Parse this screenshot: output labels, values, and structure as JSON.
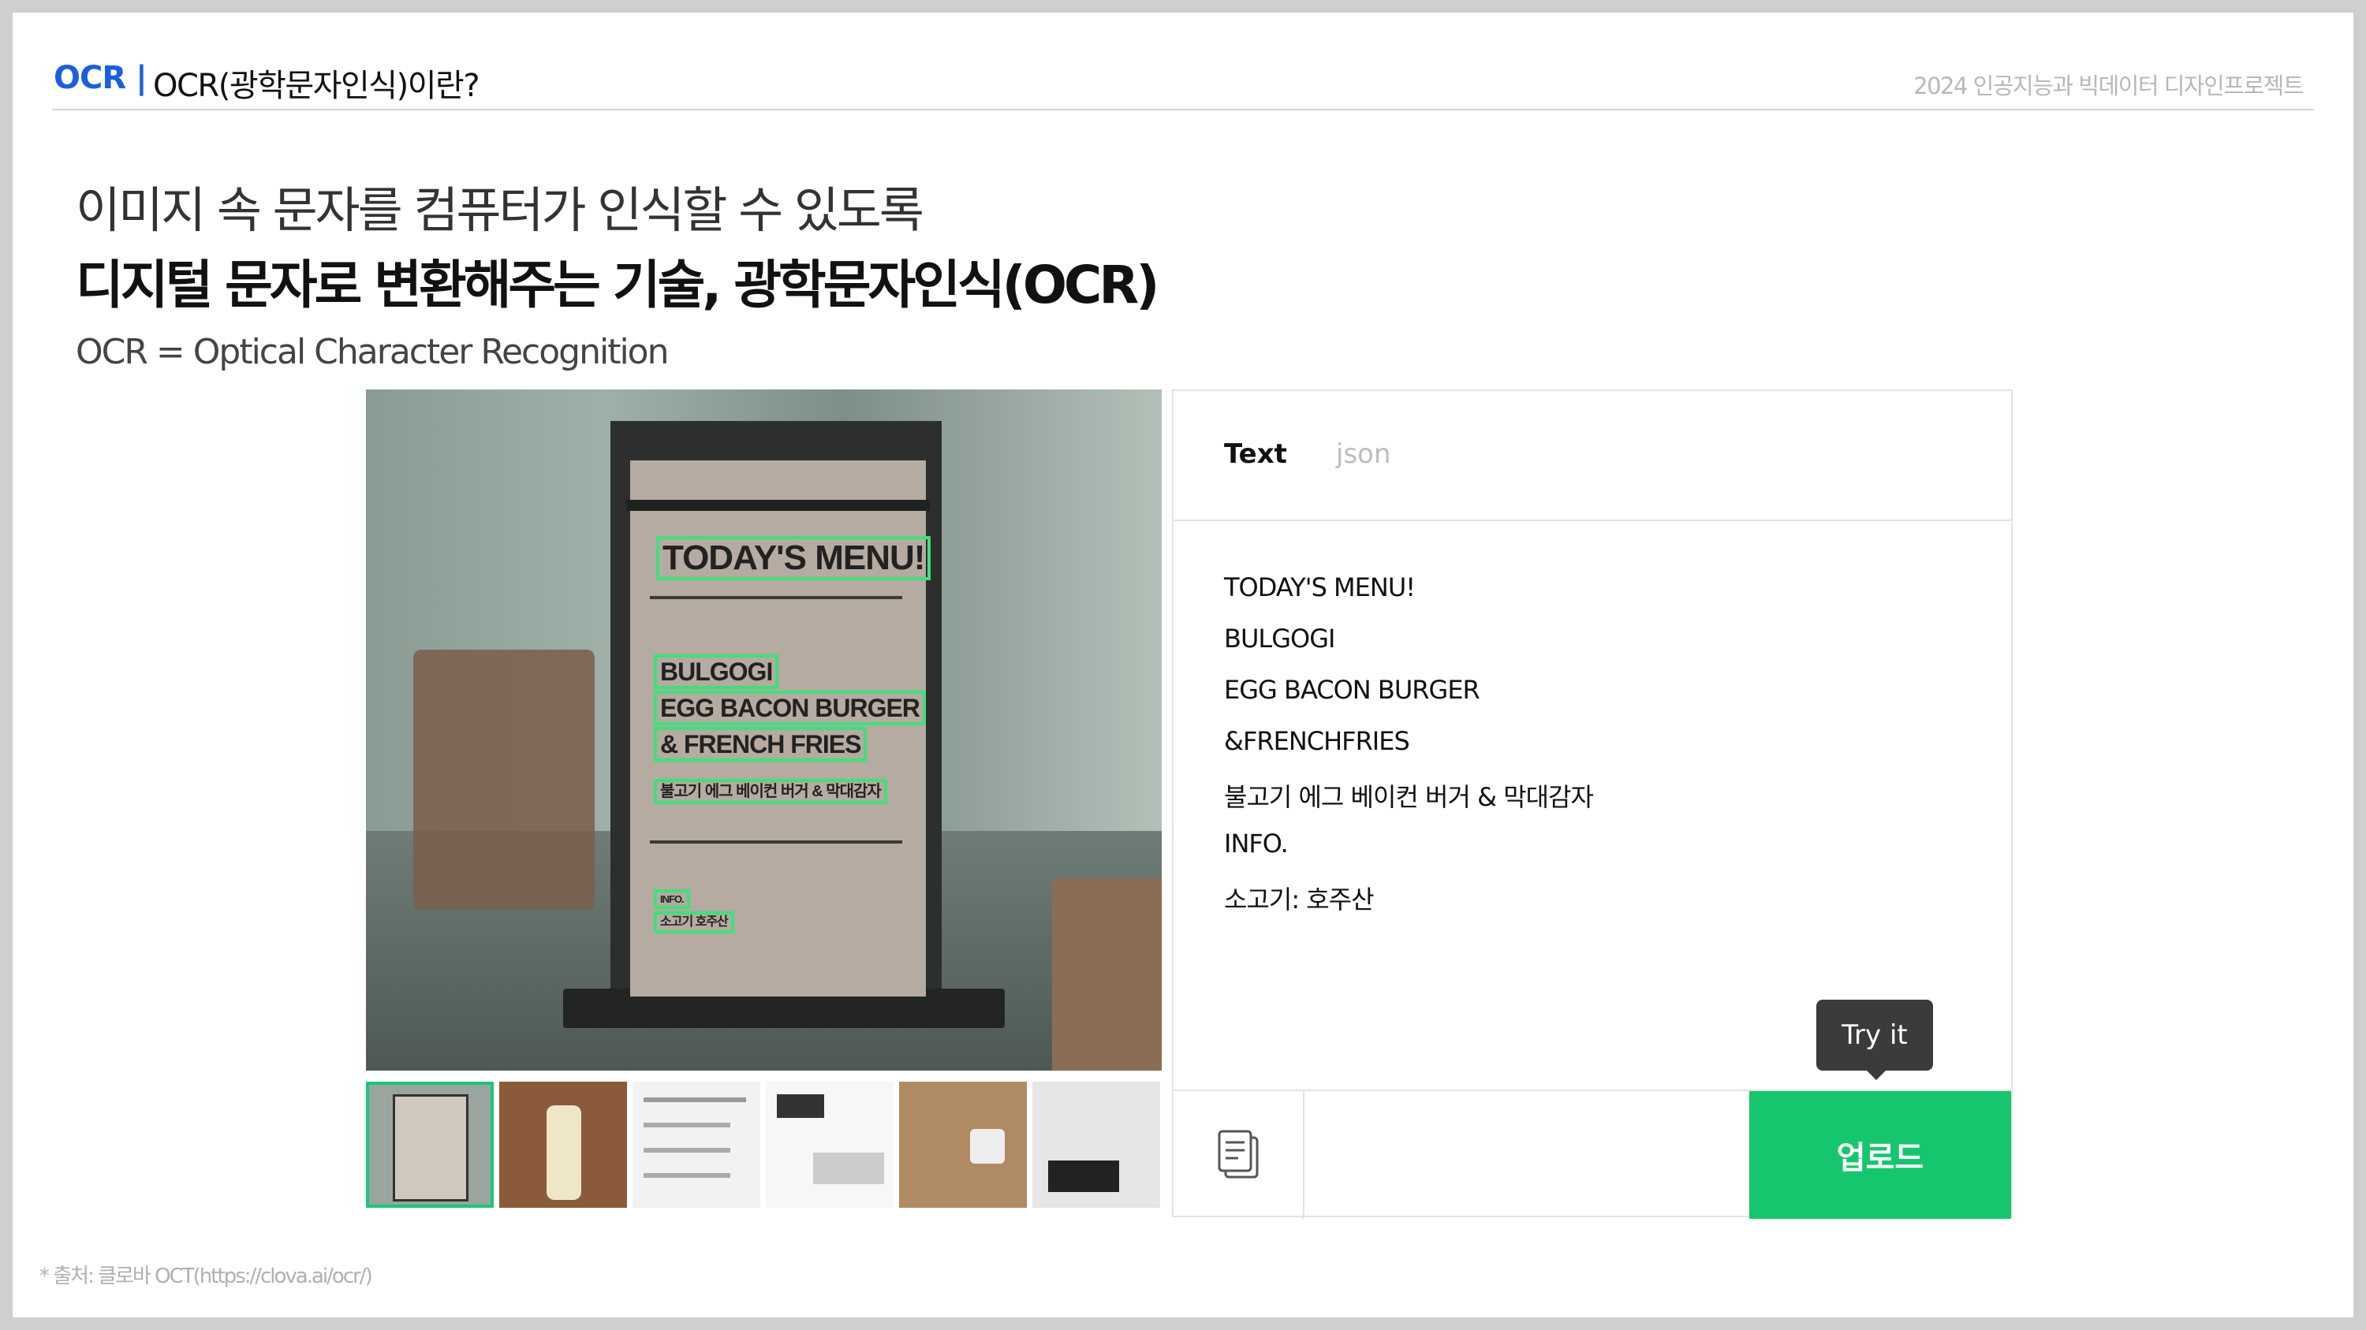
{
  "header": {
    "tag": "OCR |",
    "title": "OCR(광학문자인식)이란?",
    "project": "2024 인공지능과 빅데이터 디자인프로젝트"
  },
  "headline": {
    "line1": "이미지 속 문자를 컴퓨터가 인식할 수 있도록",
    "line2": "디지털 문자로 변환해주는 기술, 광학문자인식(OCR)",
    "subline": "OCR = Optical Character Recognition"
  },
  "photo": {
    "detected": [
      "TODAY'S MENU!",
      "BULGOGI",
      "EGG BACON BURGER",
      "& FRENCH FRIES",
      "불고기 에그 베이컨 버거 & 막대감자",
      "INFO.",
      "소고기 호주산"
    ]
  },
  "thumbnails": [
    {
      "label": "menu-stand",
      "color": "#9aa59f"
    },
    {
      "label": "can",
      "color": "#8a5a3a"
    },
    {
      "label": "instructions-sheet",
      "color": "#f2f2f2"
    },
    {
      "label": "poster",
      "color": "#f7f7f7"
    },
    {
      "label": "wood-sign",
      "color": "#b08a63"
    },
    {
      "label": "shop-sign",
      "color": "#e6e6e6"
    }
  ],
  "panel": {
    "tab_text": "Text",
    "tab_json": "json",
    "results": [
      "TODAY'S MENU!",
      "BULGOGI",
      "EGG BACON BURGER",
      "&FRENCHFRIES",
      "불고기 에그 베이컨 버거 & 막대감자",
      "INFO.",
      "소고기: 호주산"
    ],
    "tooltip": "Try it",
    "upload_label": "업로드",
    "copy_icon": "copy-icon"
  },
  "footnote": "* 출처: 클로바 OCT(https://clova.ai/ocr/)",
  "colors": {
    "accent_blue": "#1a5fe0",
    "upload_green": "#16c66e",
    "ocr_box_green": "#3fe07a"
  }
}
